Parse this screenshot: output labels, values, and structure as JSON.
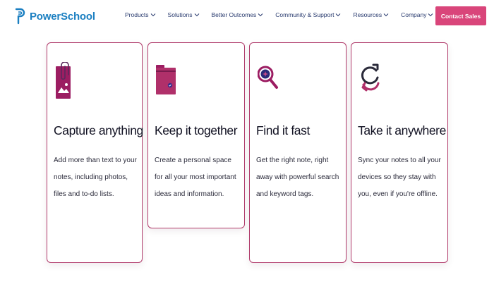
{
  "brand": {
    "name": "PowerSchool",
    "color": "#1b7fc1"
  },
  "nav": {
    "items": [
      {
        "label": "Products",
        "icon": "chevron-down-icon"
      },
      {
        "label": "Solutions",
        "icon": "chevron-down-icon"
      },
      {
        "label": "Better Outcomes",
        "icon": "chevron-down-icon"
      },
      {
        "label": "Community & Support",
        "icon": "chevron-down-icon"
      },
      {
        "label": "Resources",
        "icon": "chevron-down-icon"
      },
      {
        "label": "Company",
        "icon": "chevron-down-icon"
      }
    ],
    "cta_label": "Contact Sales",
    "cta_color": "#d9457a"
  },
  "features": {
    "accent_color": "#b0306a",
    "cards": [
      {
        "icon": "attachment-image-icon",
        "title": "Capture anything",
        "description": "Add more than text to your notes, including photos, files and to-do lists."
      },
      {
        "icon": "folder-icon",
        "title": "Keep it together",
        "description": "Create a personal space for all your most important ideas and information."
      },
      {
        "icon": "search-icon",
        "title": "Find it fast",
        "description": "Get the right note, right away with powerful search and keyword tags."
      },
      {
        "icon": "sync-icon",
        "title": "Take it anywhere",
        "description": "Sync your notes to all your devices so they stay with you, even if you're offline."
      }
    ]
  }
}
